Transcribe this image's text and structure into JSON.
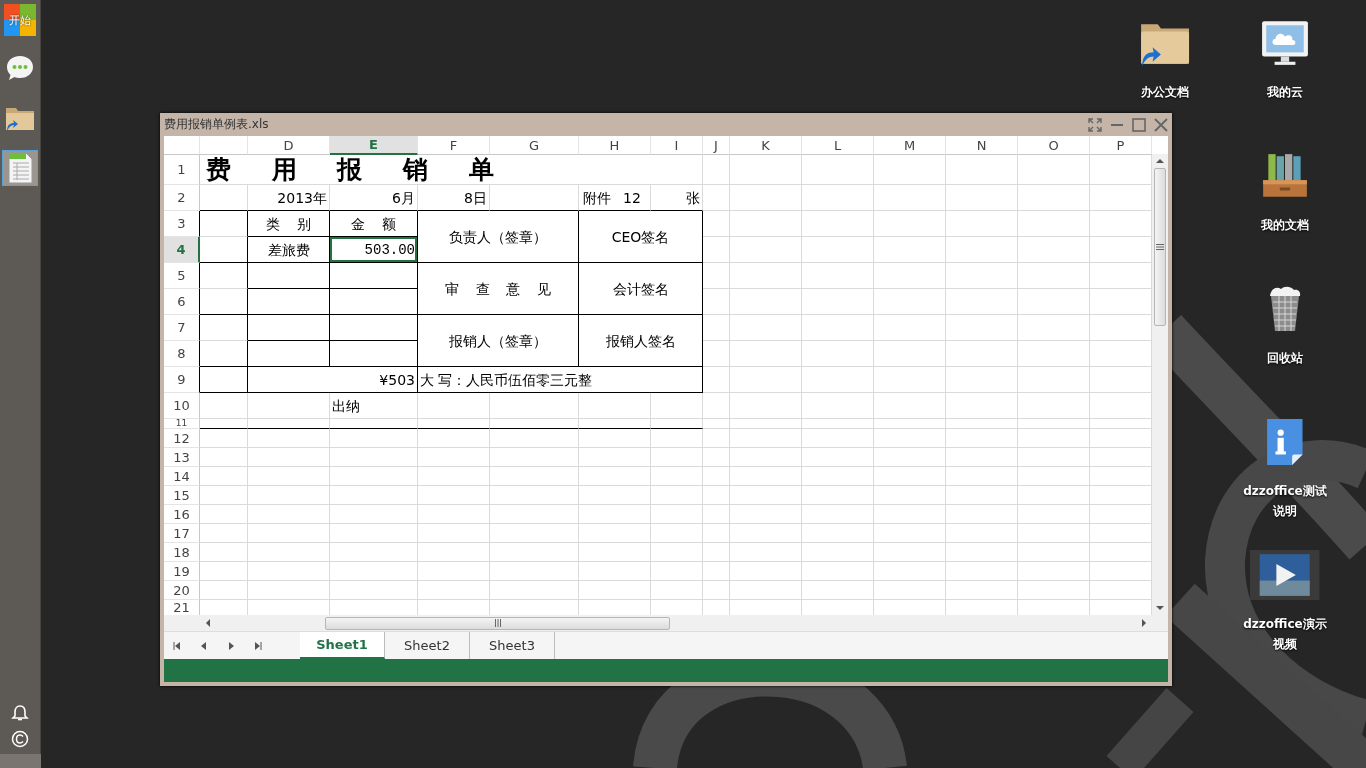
{
  "taskbar": {
    "start_label": "开始",
    "apps": [
      {
        "kind": "chat",
        "selected": false
      },
      {
        "kind": "folder",
        "selected": false
      },
      {
        "kind": "spreadsheet",
        "selected": true
      }
    ]
  },
  "desktop_icons": [
    {
      "label": "办公文档",
      "kind": "folder"
    },
    {
      "label": "我的云",
      "kind": "cloud"
    },
    {
      "label": "我的文档",
      "kind": "binders"
    },
    {
      "label": "回收站",
      "kind": "trash"
    },
    {
      "label": "dzzoffice测试说明",
      "kind": "info"
    },
    {
      "label": "dzzoffice演示视频",
      "kind": "video"
    }
  ],
  "window": {
    "title": "费用报销单例表.xls"
  },
  "sheet": {
    "columns": [
      {
        "label": "D",
        "selected": false
      },
      {
        "label": "E",
        "selected": true
      },
      {
        "label": "F",
        "selected": false
      },
      {
        "label": "G",
        "selected": false
      },
      {
        "label": "H",
        "selected": false
      },
      {
        "label": "I",
        "selected": false
      },
      {
        "label": "J",
        "selected": false
      },
      {
        "label": "K",
        "selected": false
      },
      {
        "label": "L",
        "selected": false
      },
      {
        "label": "M",
        "selected": false
      },
      {
        "label": "N",
        "selected": false
      },
      {
        "label": "O",
        "selected": false
      },
      {
        "label": "P",
        "selected": false
      }
    ],
    "rows": [
      {
        "label": "1",
        "selected": false
      },
      {
        "label": "2",
        "selected": false
      },
      {
        "label": "3",
        "selected": false
      },
      {
        "label": "4",
        "selected": true
      },
      {
        "label": "5",
        "selected": false
      },
      {
        "label": "6",
        "selected": false
      },
      {
        "label": "7",
        "selected": false
      },
      {
        "label": "8",
        "selected": false
      },
      {
        "label": "9",
        "selected": false
      },
      {
        "label": "10",
        "selected": false
      },
      {
        "label": "11",
        "selected": false
      },
      {
        "label": "12",
        "selected": false
      },
      {
        "label": "13",
        "selected": false
      },
      {
        "label": "14",
        "selected": false
      },
      {
        "label": "15",
        "selected": false
      },
      {
        "label": "16",
        "selected": false
      },
      {
        "label": "17",
        "selected": false
      },
      {
        "label": "18",
        "selected": false
      },
      {
        "label": "19",
        "selected": false
      },
      {
        "label": "20",
        "selected": false
      },
      {
        "label": "21",
        "selected": false
      }
    ]
  },
  "form": {
    "title": "费 用 报 销 单",
    "year": "2013年",
    "month": "6月",
    "day": "8日",
    "attachment_label": "附件",
    "attachment_count": "12",
    "attachment_unit": "张",
    "category_header": "类 别",
    "amount_header": "金 额",
    "items": [
      {
        "category": "差旅费",
        "amount": "503.00",
        "selected": true
      }
    ],
    "signatures": [
      {
        "role": "负责人（签章）",
        "sign": "CEO签名"
      },
      {
        "role": "审 查 意 见",
        "sign": "会计签名"
      },
      {
        "role": "报销人（签章）",
        "sign": "报销人签名"
      }
    ],
    "total": "¥503",
    "total_words": "大 写：人民币伍佰零三元整",
    "cashier": "出纳"
  },
  "sheet_tabs": [
    {
      "label": "Sheet1",
      "selected": true
    },
    {
      "label": "Sheet2",
      "selected": false
    },
    {
      "label": "Sheet3",
      "selected": false
    }
  ]
}
